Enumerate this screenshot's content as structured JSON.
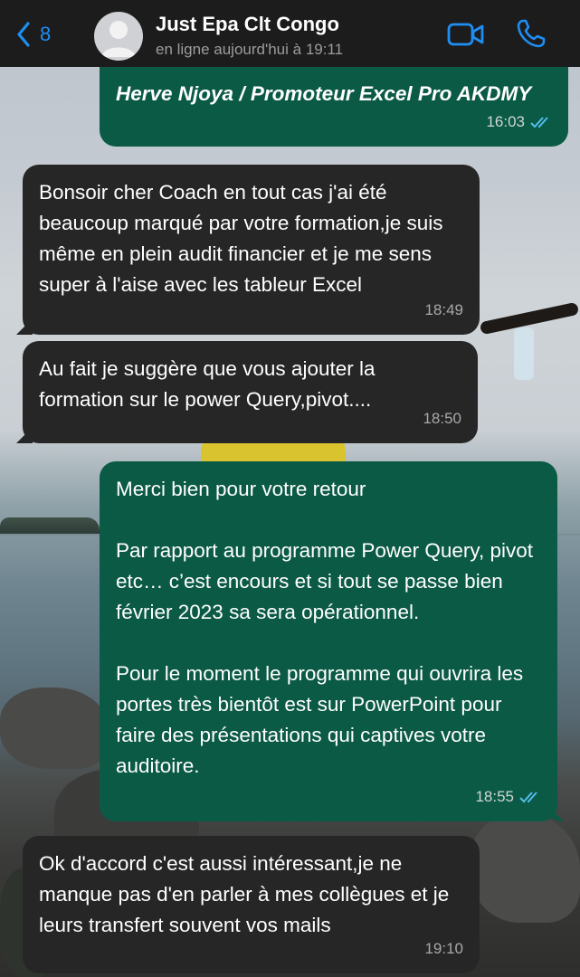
{
  "header": {
    "back_count": "8",
    "contact_name": "Just Epa Clt Congo",
    "status": "en ligne aujourd'hui à 19:11"
  },
  "messages": [
    {
      "direction": "outgoing",
      "text": "Herve Njoya / Promoteur Excel Pro AKDMY",
      "time": "16:03",
      "read": true
    },
    {
      "direction": "incoming",
      "text": "Bonsoir cher Coach en tout cas j'ai été beaucoup marqué par votre formation,je suis même en plein audit financier et je me sens super à l'aise avec les tableur Excel",
      "time": "18:49"
    },
    {
      "direction": "incoming",
      "text": "Au fait je suggère que vous ajouter la formation sur le power Query,pivot....",
      "time": "18:50"
    },
    {
      "direction": "outgoing",
      "text": "Merci bien pour votre retour\n\nPar rapport au programme Power Query, pivot etc… c’est encours et si tout se passe bien février 2023 sa sera opérationnel.\n\nPour le moment le programme qui ouvrira les portes très bientôt est sur PowerPoint pour faire des présentations qui captives votre auditoire.",
      "time": "18:55",
      "read": true
    },
    {
      "direction": "incoming",
      "text": "Ok d'accord c'est aussi intéressant,je ne manque pas d'en parler à mes collègues et je leurs transfert souvent vos mails",
      "time": "19:10"
    }
  ],
  "colors": {
    "header_bg": "#1c1c1c",
    "accent": "#1f8ef1",
    "outgoing_bubble": "#0b5a45",
    "incoming_bubble": "#262627",
    "read_ticks": "#53bdeb"
  }
}
